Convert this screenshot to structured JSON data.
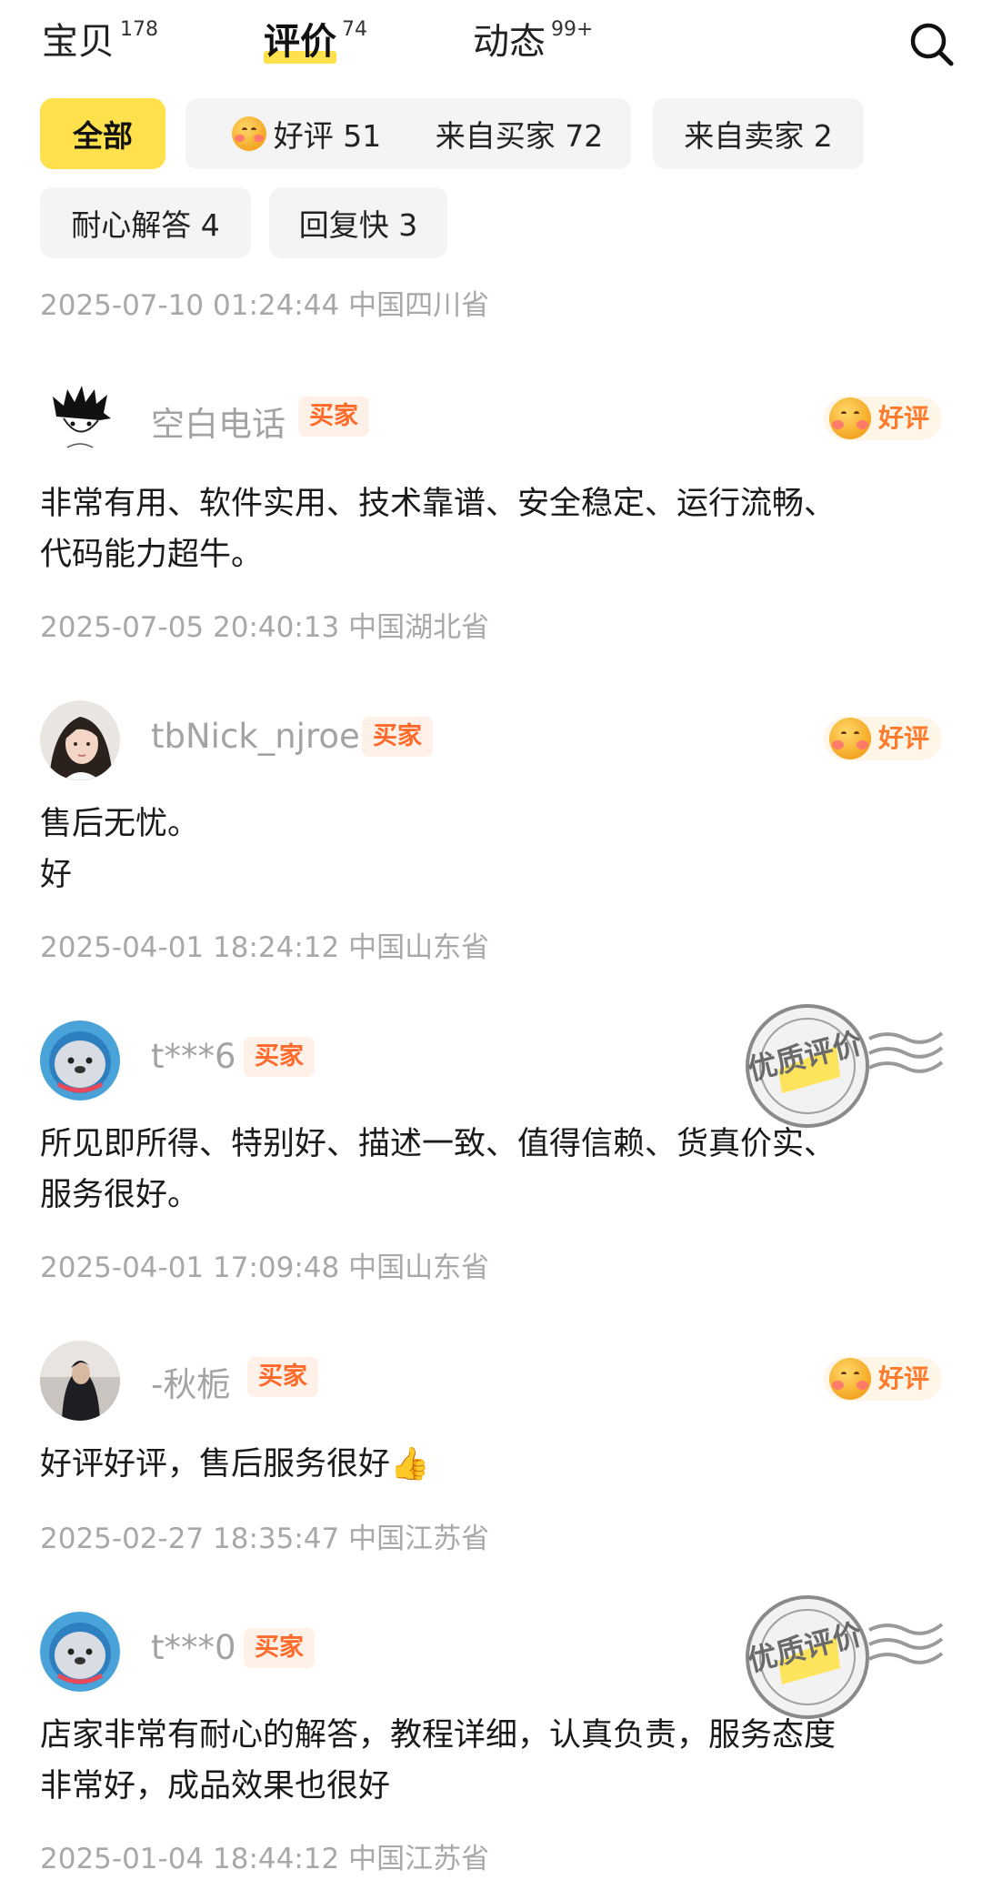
{
  "tabs": [
    {
      "label": "宝贝",
      "count": "178",
      "active": false
    },
    {
      "label": "评价",
      "count": "74",
      "active": true
    },
    {
      "label": "动态",
      "count": "99+",
      "active": false
    }
  ],
  "search_icon": "search-icon",
  "filters": [
    {
      "label": "全部",
      "active": true
    },
    {
      "label": "好评 51",
      "icon": "good-rating-emoji-icon"
    },
    {
      "label": "来自买家 72"
    },
    {
      "label": "来自卖家 2"
    },
    {
      "label": "耐心解答 4"
    },
    {
      "label": "回复快 3"
    }
  ],
  "first_meta": "2025-07-10 01:24:44 中国四川省",
  "reviews": [
    {
      "username": "空白电话",
      "role": "买家",
      "rating": "好评",
      "text": "非常有用、软件实用、技术靠谱、安全稳定、运行流畅、\n代码能力超牛。",
      "meta": "2025-07-05 20:40:13 中国湖北省",
      "avatar": "sketch-boy-avatar"
    },
    {
      "username": "tbNick_njroe",
      "role": "买家",
      "rating": "好评",
      "text": "售后无忧。\n好",
      "meta": "2025-04-01 18:24:12 中国山东省",
      "avatar": "girl-photo-avatar"
    },
    {
      "username": "t***6",
      "role": "买家",
      "text": "所见即所得、特别好、描述一致、值得信赖、货真价实、\n服务很好。",
      "meta": "2025-04-01 17:09:48 中国山东省",
      "avatar": "seal-avatar",
      "stamp": {
        "brand": "XIANYU",
        "main": "优质评价",
        "sub": "Excellent"
      }
    },
    {
      "username": "-秋栀",
      "role": "买家",
      "rating": "好评",
      "text": "好评好评，售后服务很好👍",
      "meta": "2025-02-27 18:35:47 中国江苏省",
      "avatar": "dark-photo-avatar"
    },
    {
      "username": "t***0",
      "role": "买家",
      "text": "店家非常有耐心的解答，教程详细，认真负责，服务态度\n非常好，成品效果也很好",
      "meta": "2025-01-04 18:44:12 中国江苏省",
      "avatar": "seal-avatar",
      "stamp": {
        "brand": "XIANYU",
        "main": "优质评价",
        "sub": "Excellent"
      }
    }
  ],
  "colors": {
    "accent_yellow": "#ffe14d",
    "buyer_badge_text": "#ff6a2b",
    "buyer_badge_bg": "#fff1e8",
    "meta_gray": "#a8a8a8"
  }
}
